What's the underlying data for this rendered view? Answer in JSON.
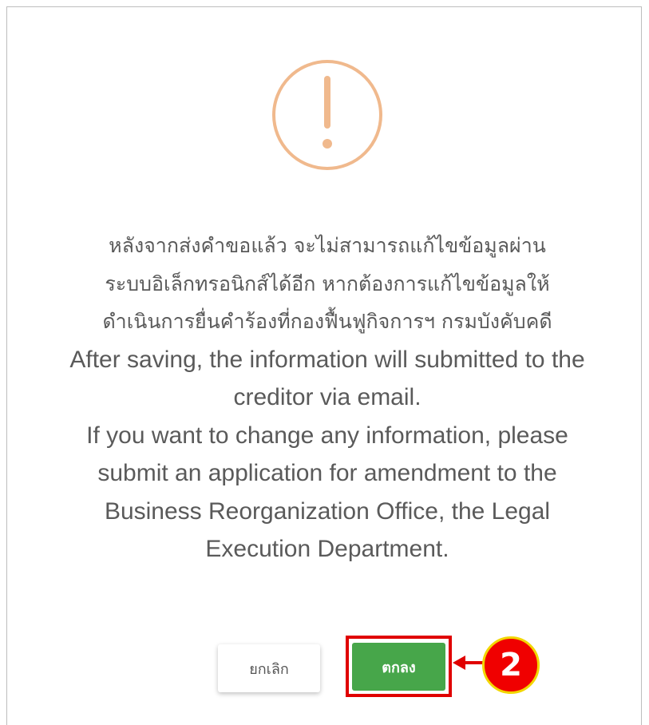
{
  "dialog": {
    "message_lines": [
      "หลังจากส่งคำขอแล้ว จะไม่สามารถแก้ไขข้อมูลผ่าน",
      "ระบบอิเล็กทรอนิกส์ได้อีก หากต้องการแก้ไขข้อมูลให้",
      "ดำเนินการยื่นคำร้องที่กองฟื้นฟูกิจการฯ กรมบังคับคดี",
      "After saving, the information will submitted to the",
      "creditor via email.",
      "If you want to change any information, please",
      "submit an application for amendment to the",
      "Business Reorganization Office, the Legal",
      "Execution Department."
    ],
    "cancel_label": "ยกเลิก",
    "ok_label": "ตกลง",
    "warning_icon": "exclamation-circle-icon",
    "colors": {
      "warning": "#f0b98d",
      "ok_button": "#47a64a",
      "highlight": "#e00000",
      "badge_border": "#f2d600"
    }
  },
  "annotation": {
    "step_number": "2"
  }
}
